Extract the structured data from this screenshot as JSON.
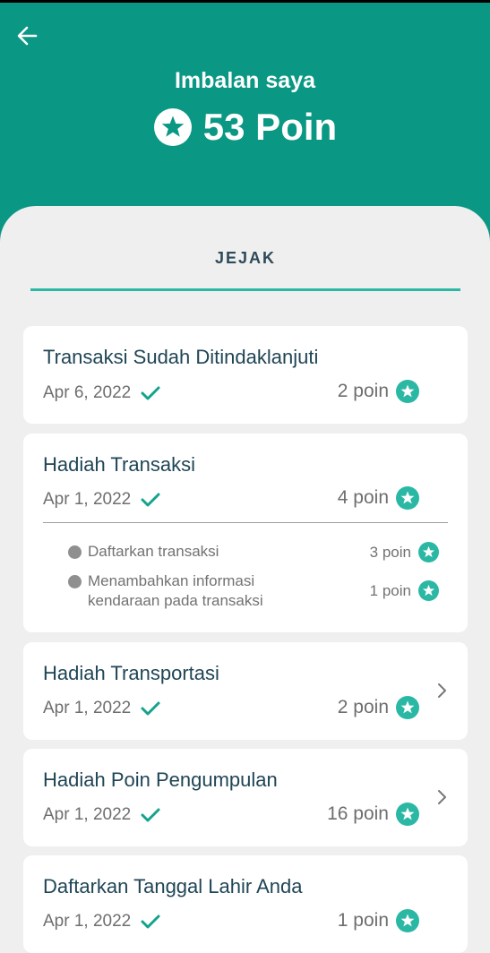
{
  "header": {
    "title": "Imbalan saya",
    "points": "53 Poin"
  },
  "tabs": [
    {
      "label": "JEJAK"
    }
  ],
  "colors": {
    "primary": "#0a9784",
    "accent": "#2ab8a4",
    "title_text": "#1f4555"
  },
  "cards": [
    {
      "title": "Transaksi Sudah Ditindaklanjuti",
      "date": "Apr 6, 2022",
      "points": "2 poin"
    },
    {
      "title": "Hadiah Transaksi",
      "date": "Apr 1, 2022",
      "points": "4 poin",
      "sub_items": [
        {
          "label": "Daftarkan transaksi",
          "points": "3 poin"
        },
        {
          "label": "Menambahkan informasi\nkendaraan pada transaksi",
          "points": "1 poin"
        }
      ]
    },
    {
      "title": "Hadiah Transportasi",
      "date": "Apr 1, 2022",
      "points": "2 poin"
    },
    {
      "title": "Hadiah Poin Pengumpulan",
      "date": "Apr 1, 2022",
      "points": "16 poin"
    },
    {
      "title": "Daftarkan Tanggal Lahir Anda",
      "date": "Apr 1, 2022",
      "points": "1 poin"
    }
  ],
  "icons": {
    "back": "arrow-left-icon",
    "star": "star-icon",
    "check": "check-icon",
    "chevron": "chevron-right-icon"
  }
}
